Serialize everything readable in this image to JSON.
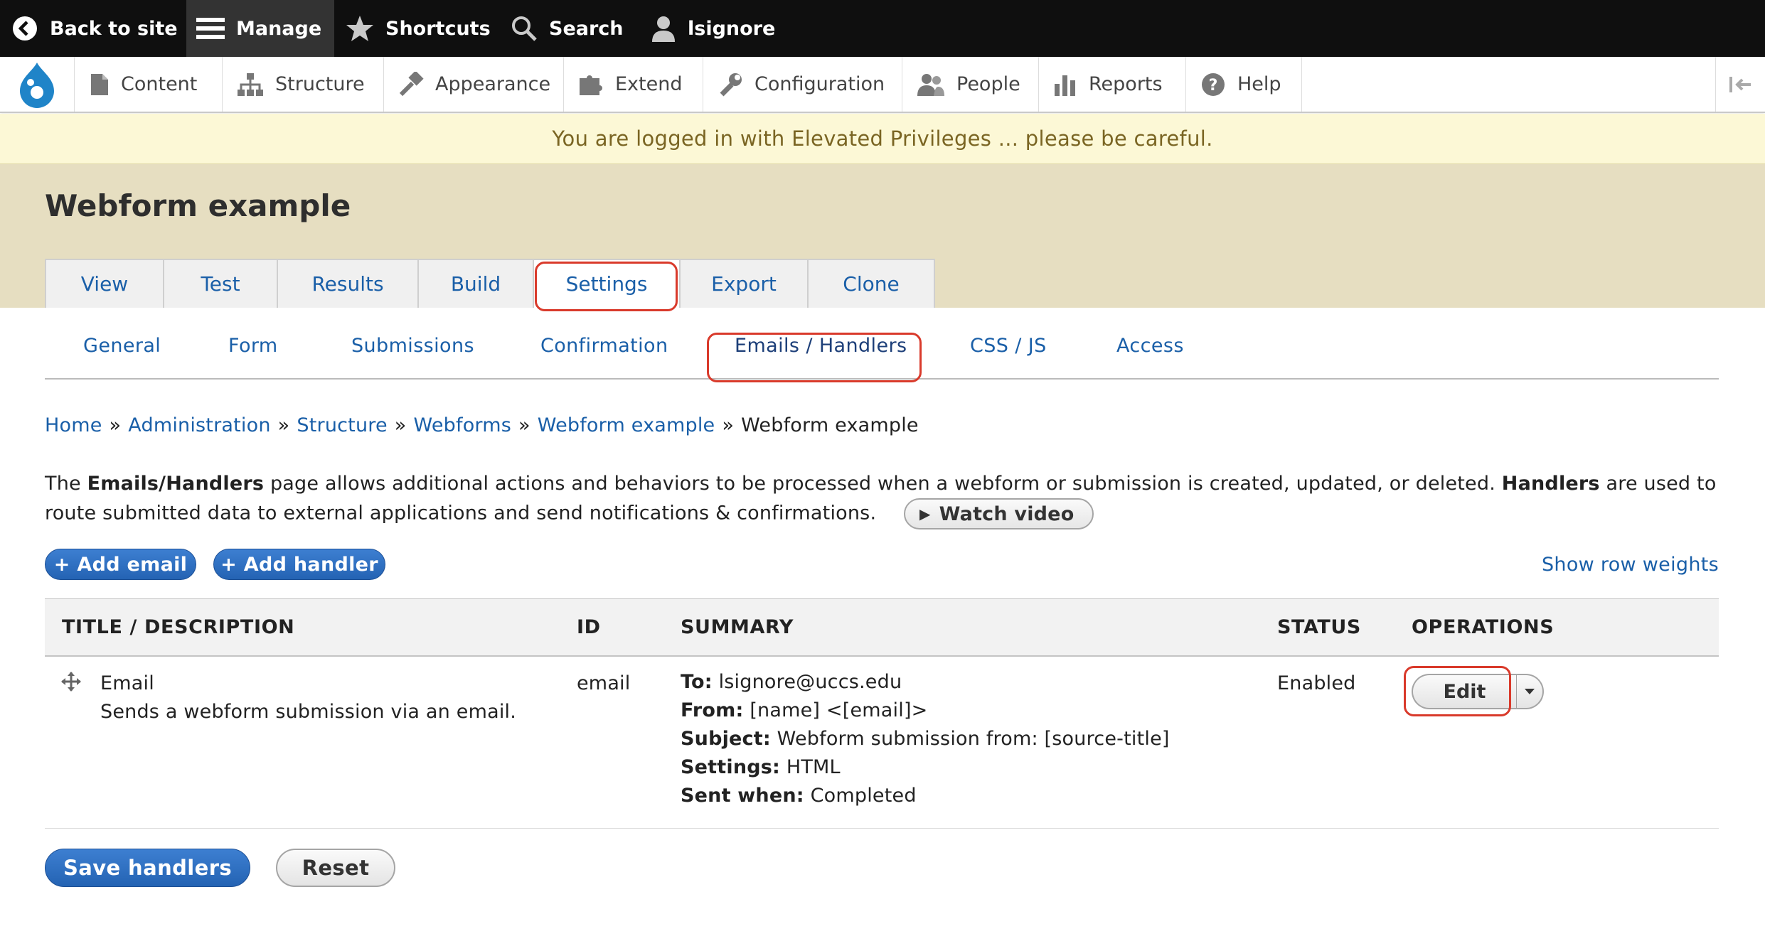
{
  "toolbar": {
    "back": "Back to site",
    "manage": "Manage",
    "shortcuts": "Shortcuts",
    "search": "Search",
    "user": "lsignore"
  },
  "admin_menu": {
    "items": [
      {
        "label": "Content",
        "icon": "content-icon"
      },
      {
        "label": "Structure",
        "icon": "structure-icon"
      },
      {
        "label": "Appearance",
        "icon": "appearance-icon"
      },
      {
        "label": "Extend",
        "icon": "extend-icon"
      },
      {
        "label": "Configuration",
        "icon": "wrench-icon"
      },
      {
        "label": "People",
        "icon": "people-icon"
      },
      {
        "label": "Reports",
        "icon": "reports-icon"
      },
      {
        "label": "Help",
        "icon": "help-icon"
      }
    ]
  },
  "warning": "You are logged in with Elevated Privileges ... please be careful.",
  "page": {
    "title": "Webform example",
    "primary_tabs": [
      "View",
      "Test",
      "Results",
      "Build",
      "Settings",
      "Export",
      "Clone"
    ],
    "active_primary_tab": "Settings",
    "secondary_tabs": [
      "General",
      "Form",
      "Submissions",
      "Confirmation",
      "Emails / Handlers",
      "CSS / JS",
      "Access"
    ],
    "active_secondary_tab": "Emails / Handlers"
  },
  "breadcrumb": {
    "links": [
      "Home",
      "Administration",
      "Structure",
      "Webforms",
      "Webform example"
    ],
    "current": "Webform example",
    "separator": "»"
  },
  "description": {
    "part1": "The ",
    "bold1": "Emails/Handlers",
    "part2": " page allows additional actions and behaviors to be processed when a webform or submission is created, updated, or deleted. ",
    "bold2": "Handlers",
    "part3": " are used to route submitted data to external applications and send notifications & confirmations.",
    "video_button": "Watch video"
  },
  "actions": {
    "add_email": "+ Add email",
    "add_handler": "+ Add handler",
    "row_weights": "Show row weights"
  },
  "table": {
    "headers": [
      "TITLE / DESCRIPTION",
      "ID",
      "SUMMARY",
      "STATUS",
      "OPERATIONS"
    ],
    "rows": [
      {
        "title": "Email",
        "description": "Sends a webform submission via an email.",
        "id": "email",
        "summary": [
          {
            "key": "To:",
            "value": "lsignore@uccs.edu"
          },
          {
            "key": "From:",
            "value": "[name] <[email]>"
          },
          {
            "key": "Subject:",
            "value": "Webform submission from: [source-title]"
          },
          {
            "key": "Settings:",
            "value": "HTML"
          },
          {
            "key": "Sent when:",
            "value": "Completed"
          }
        ],
        "status": "Enabled",
        "operation": "Edit"
      }
    ]
  },
  "footer": {
    "save": "Save handlers",
    "reset": "Reset"
  },
  "colors": {
    "link": "#1a5fa8",
    "primary_button": "#2463b3",
    "highlight": "#d93a2b",
    "header_band": "#e6dec1",
    "warning_bg": "#fcf8d6"
  }
}
